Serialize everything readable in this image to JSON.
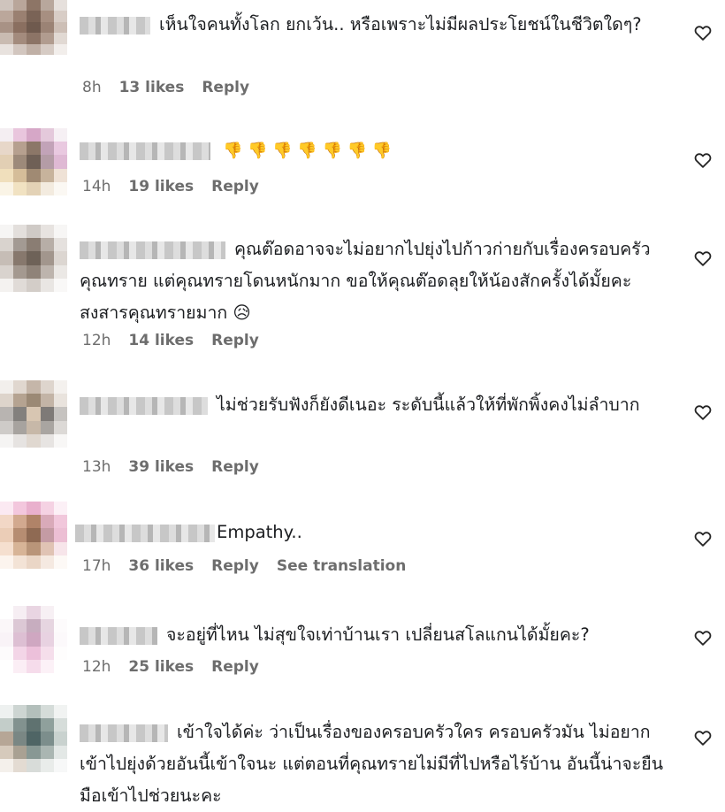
{
  "comments": [
    {
      "text": "เห็นใจคนทั้งโลก ยกเว้น.. หรือเพราะไม่มีผลประโยชน์ในชีวิตใดๆ?",
      "time": "8h",
      "likes": "13 likes",
      "reply": "Reply"
    },
    {
      "text": "👎 👎 👎 👎 👎 👎 👎",
      "time": "14h",
      "likes": "19 likes",
      "reply": "Reply"
    },
    {
      "text": "คุณต๊อดอาจจะไม่อยากไปยุ่งไปก้าวก่ายกับเรื่องครอบครัวคุณทราย แต่คุณทรายโดนหนักมาก ขอให้คุณต๊อดลุยให้น้องสักครั้งได้มั้ยคะ สงสารคุณทรายมาก 😥",
      "time": "12h",
      "likes": "14 likes",
      "reply": "Reply"
    },
    {
      "text": "ไม่ช่วยรับฟังก็ยังดีเนอะ ระดับนี้แล้วให้ที่พักพิ้งคงไม่ลำบาก",
      "time": "13h",
      "likes": "39 likes",
      "reply": "Reply"
    },
    {
      "text": "Empathy..",
      "time": "17h",
      "likes": "36 likes",
      "reply": "Reply",
      "translate": "See translation"
    },
    {
      "text": "จะอยู่ที่ไหน ไม่สุขใจเท่าบ้านเรา เปลี่ยนสโลแกนได้มั้ยคะ?",
      "time": "12h",
      "likes": "25 likes",
      "reply": "Reply"
    },
    {
      "text": "เข้าใจได้ค่ะ ว่าเป็นเรื่องของครอบครัวใคร ครอบครัวมัน ไม่อยากเข้าไปยุ่งด้วยอันนี้เข้าใจนะ แต่ตอนที่คุณทรายไม่มีที่ไปหรือไร้บ้าน อันนี้น่าจะยืนมือเข้าไปช่วยนะคะ"
    }
  ],
  "colors": {
    "meta": "#6d6d6d",
    "text": "#1c1e21",
    "background": "#ffffff"
  },
  "icons": {
    "like": "heart-outline-icon"
  }
}
